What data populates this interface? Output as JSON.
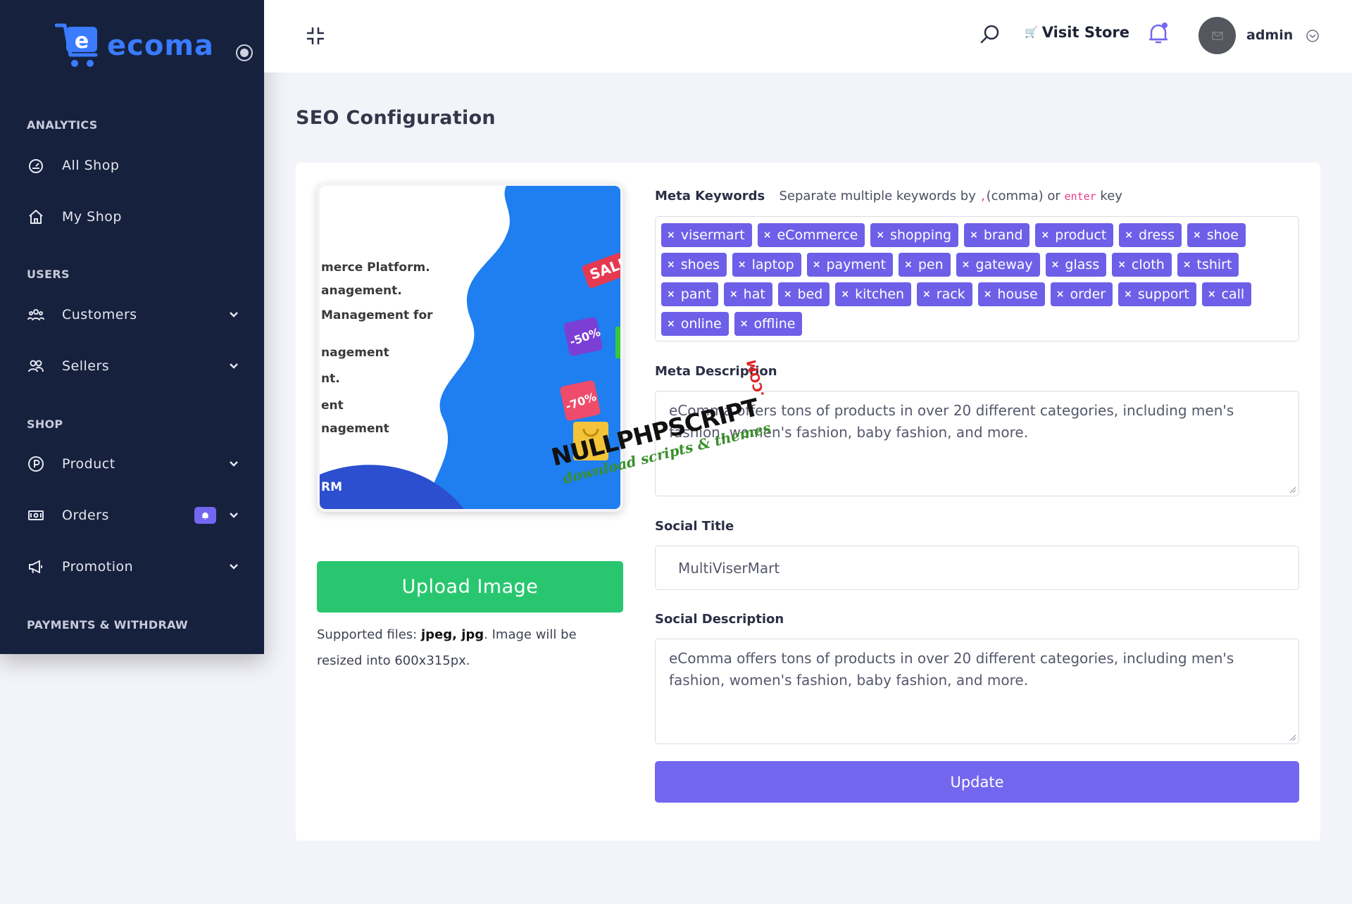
{
  "app": {
    "logo_text": "ecoma",
    "logo_letter": "e"
  },
  "sidebar": {
    "sections": [
      {
        "title": "ANALYTICS"
      },
      {
        "title": "USERS"
      },
      {
        "title": "SHOP"
      },
      {
        "title": "PAYMENTS & WITHDRAW"
      }
    ],
    "items": [
      {
        "label": "All Shop",
        "icon": "dashboard-gauge-icon"
      },
      {
        "label": "My Shop",
        "icon": "home-icon"
      },
      {
        "label": "Customers",
        "icon": "users-group-icon"
      },
      {
        "label": "Sellers",
        "icon": "users-pair-icon"
      },
      {
        "label": "Product",
        "icon": "product-p-icon"
      },
      {
        "label": "Orders",
        "icon": "money-bill-icon"
      },
      {
        "label": "Promotion",
        "icon": "megaphone-icon"
      }
    ]
  },
  "header": {
    "visit_store": "Visit Store",
    "user_name": "admin"
  },
  "page": {
    "title": "SEO Configuration"
  },
  "image_preview": {
    "text_lines": [
      "merce Platform.",
      "anagement.",
      "Management for",
      "nagement",
      "nt.",
      "ent",
      "nagement",
      "RM"
    ],
    "badges": [
      "SALE",
      "-50%",
      "-70%"
    ]
  },
  "upload": {
    "button_label": "Upload Image",
    "support_prefix": "Supported files: ",
    "support_types": "jpeg, jpg",
    "support_suffix": ". Image will be resized into 600x315px."
  },
  "meta_keywords": {
    "label": "Meta Keywords",
    "hint_prefix": "Separate multiple keywords by ",
    "hint_comma_code": ",",
    "hint_middle": "(comma) or ",
    "hint_enter_code": "enter",
    "hint_suffix": " key",
    "tags": [
      "visermart",
      "eCommerce",
      "shopping",
      "brand",
      "product",
      "dress",
      "shoe",
      "shoes",
      "laptop",
      "payment",
      "pen",
      "gateway",
      "glass",
      "cloth",
      "tshirt",
      "pant",
      "hat",
      "bed",
      "kitchen",
      "rack",
      "house",
      "order",
      "support",
      "call",
      "online",
      "offline"
    ]
  },
  "meta_description": {
    "label": "Meta Description",
    "value": "eComma offers tons of products in over 20 different categories, including men's fashion, women's fashion, baby fashion, and more."
  },
  "social_title": {
    "label": "Social Title",
    "value": "MultiViserMart"
  },
  "social_description": {
    "label": "Social Description",
    "value": "eComma offers tons of products in over 20 different categories, including men's fashion, women's fashion, baby fashion, and more."
  },
  "actions": {
    "update_label": "Update"
  },
  "watermark": {
    "title": "NULLPHPSCRIPT",
    "subtitle": "download scripts & themes",
    "com": ".COM"
  },
  "colors": {
    "sidebar_bg": "#16213e",
    "accent": "#7367f0",
    "success": "#28c76f",
    "brand_blue": "#3a7bff"
  }
}
